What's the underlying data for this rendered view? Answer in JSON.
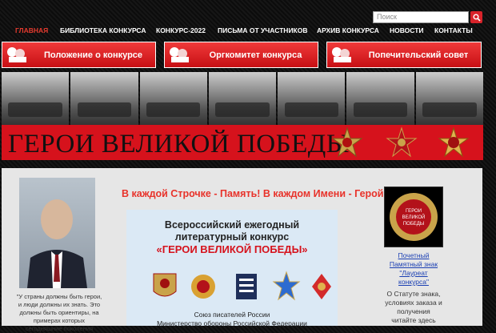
{
  "search": {
    "placeholder": "Поиск"
  },
  "nav": {
    "items": [
      "ГЛАВНАЯ",
      "БИБЛИОТЕКА КОНКУРСА",
      "КОНКУРС-2022",
      "ПИСЬМА ОТ УЧАСТНИКОВ",
      "АРХИВ КОНКУРСА",
      "НОВОСТИ",
      "КОНТАКТЫ"
    ]
  },
  "buttons": {
    "b1": "Положение о конкурсе",
    "b2": "Оргкомитет конкурса",
    "b3": "Попечительский совет"
  },
  "banner": {
    "title": "ГЕРОИ ВЕЛИКОЙ ПОБЕДЫ"
  },
  "left": {
    "quote": "\"У страны должны быть герои, и люди должны их знать. Это должны быть ориентиры, на примерах которых сегодняшние поколения"
  },
  "slogan": "В каждой Строчке - Память! В каждом Имени - Герой!",
  "card": {
    "line1": "Всероссийский ежегодный",
    "line2": "литературный конкурс",
    "line3": "«ГЕРОИ ВЕЛИКОЙ ПОБЕДЫ»",
    "sponsor1": "Союз писателей России",
    "sponsor2": "Министерство обороны  Российской Федерации"
  },
  "badge": {
    "text1": "ГЕРОИ",
    "text2": "ВЕЛИКОЙ",
    "text3": "ПОБЕДЫ"
  },
  "right": {
    "link1": "Почетный",
    "link2": "Памятный знак",
    "link3": "\"Лауреат",
    "link4": "конкурса\"",
    "text1": "О Статуте знака,",
    "text2": "условиях заказа и",
    "text3": "получения",
    "text4": "читайте здесь"
  },
  "colors": {
    "accent": "#d6121c",
    "nav_active": "#e53a2e",
    "link": "#1a3fb3"
  }
}
